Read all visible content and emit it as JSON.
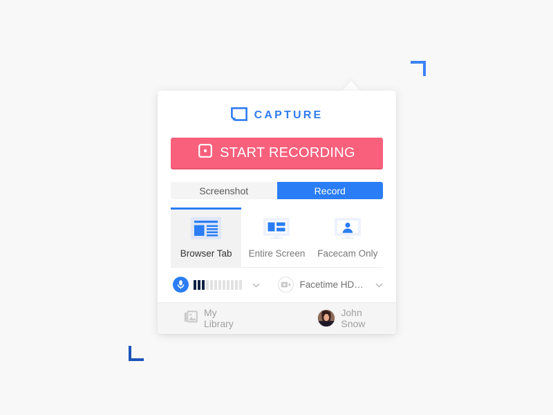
{
  "brand": {
    "name": "CAPTURE",
    "logo_icon": "capture-frame-icon",
    "color": "#2f7bf0"
  },
  "primary_action": {
    "label": "START RECORDING",
    "icon": "record-square-icon",
    "color": "#f8607c"
  },
  "segment": {
    "options": [
      {
        "label": "Screenshot",
        "active": false
      },
      {
        "label": "Record",
        "active": true
      }
    ],
    "active_color": "#2a7df4"
  },
  "modes": [
    {
      "label": "Browser Tab",
      "icon": "browser-tab-icon",
      "active": true
    },
    {
      "label": "Entire Screen",
      "icon": "monitor-icon",
      "active": false
    },
    {
      "label": "Facecam Only",
      "icon": "facecam-monitor-icon",
      "active": false
    }
  ],
  "devices": {
    "microphone": {
      "icon": "microphone-icon",
      "level_total": 12,
      "level_active": 3,
      "dropdown_icon": "chevron-down-icon"
    },
    "camera": {
      "icon": "video-camera-icon",
      "name": "Facetime HD…",
      "dropdown_icon": "chevron-down-icon"
    }
  },
  "footer": {
    "library": {
      "label": "My Library",
      "icon": "photos-stack-icon"
    },
    "user": {
      "name": "John Snow",
      "icon": "avatar"
    }
  },
  "decorations": {
    "bracket_top_right_color": "#3b82f6",
    "bracket_bottom_left_color": "#1d55b8"
  }
}
